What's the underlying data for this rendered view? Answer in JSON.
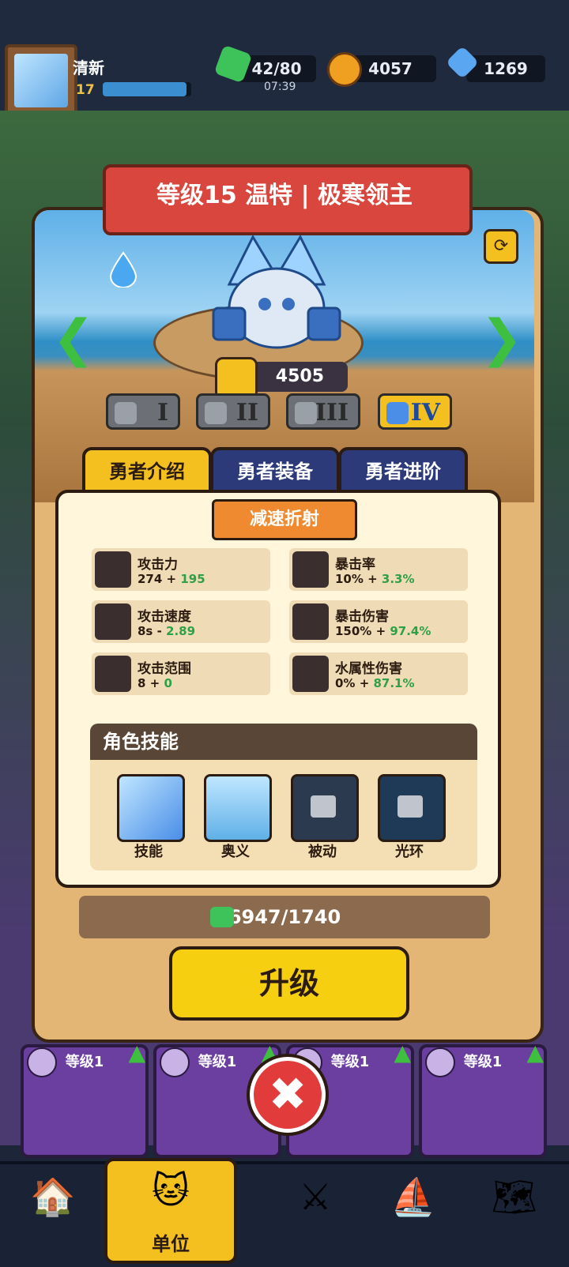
{
  "player": {
    "name": "清新",
    "level": "17",
    "xp_fraction": 0.95
  },
  "resources": {
    "energy": "42/80",
    "energy_timer": "07:39",
    "coins": "4057",
    "gems": "1269"
  },
  "hero": {
    "title": "等级15 温特 | 极寒领主",
    "power": "4505",
    "tiers": [
      "I",
      "II",
      "III",
      "IV"
    ],
    "active_tier": "IV"
  },
  "tabs": {
    "intro": "勇者介绍",
    "equip": "勇者装备",
    "advance": "勇者进阶"
  },
  "skill_banner": "减速折射",
  "stats": {
    "atk": {
      "name": "攻击力",
      "base": "274 + ",
      "bonus": "195"
    },
    "crit_rate": {
      "name": "暴击率",
      "base": "10% + ",
      "bonus": "3.3%"
    },
    "atk_speed": {
      "name": "攻击速度",
      "base": "8s - ",
      "bonus": "2.89"
    },
    "crit_dmg": {
      "name": "暴击伤害",
      "base": "150% + ",
      "bonus": "97.4%"
    },
    "atk_range": {
      "name": "攻击范围",
      "base": "8 + ",
      "bonus": "0"
    },
    "water_dmg": {
      "name": "水属性伤害",
      "base": "0% + ",
      "bonus": "87.1%"
    }
  },
  "skills": {
    "header": "角色技能",
    "items": [
      {
        "label": "技能",
        "locked": false
      },
      {
        "label": "奥义",
        "locked": false
      },
      {
        "label": "被动",
        "locked": true
      },
      {
        "label": "光环",
        "locked": true
      }
    ]
  },
  "exp": {
    "text": "6947/1740"
  },
  "upgrade_label": "升级",
  "cards": [
    {
      "level": "等级1"
    },
    {
      "level": "等级1"
    },
    {
      "level": "等级1"
    },
    {
      "level": "等级1"
    }
  ],
  "nav": {
    "units_label": "单位"
  },
  "colors": {
    "accent": "#f3c020",
    "bonus": "#2ea047",
    "banner": "#d8463d"
  }
}
